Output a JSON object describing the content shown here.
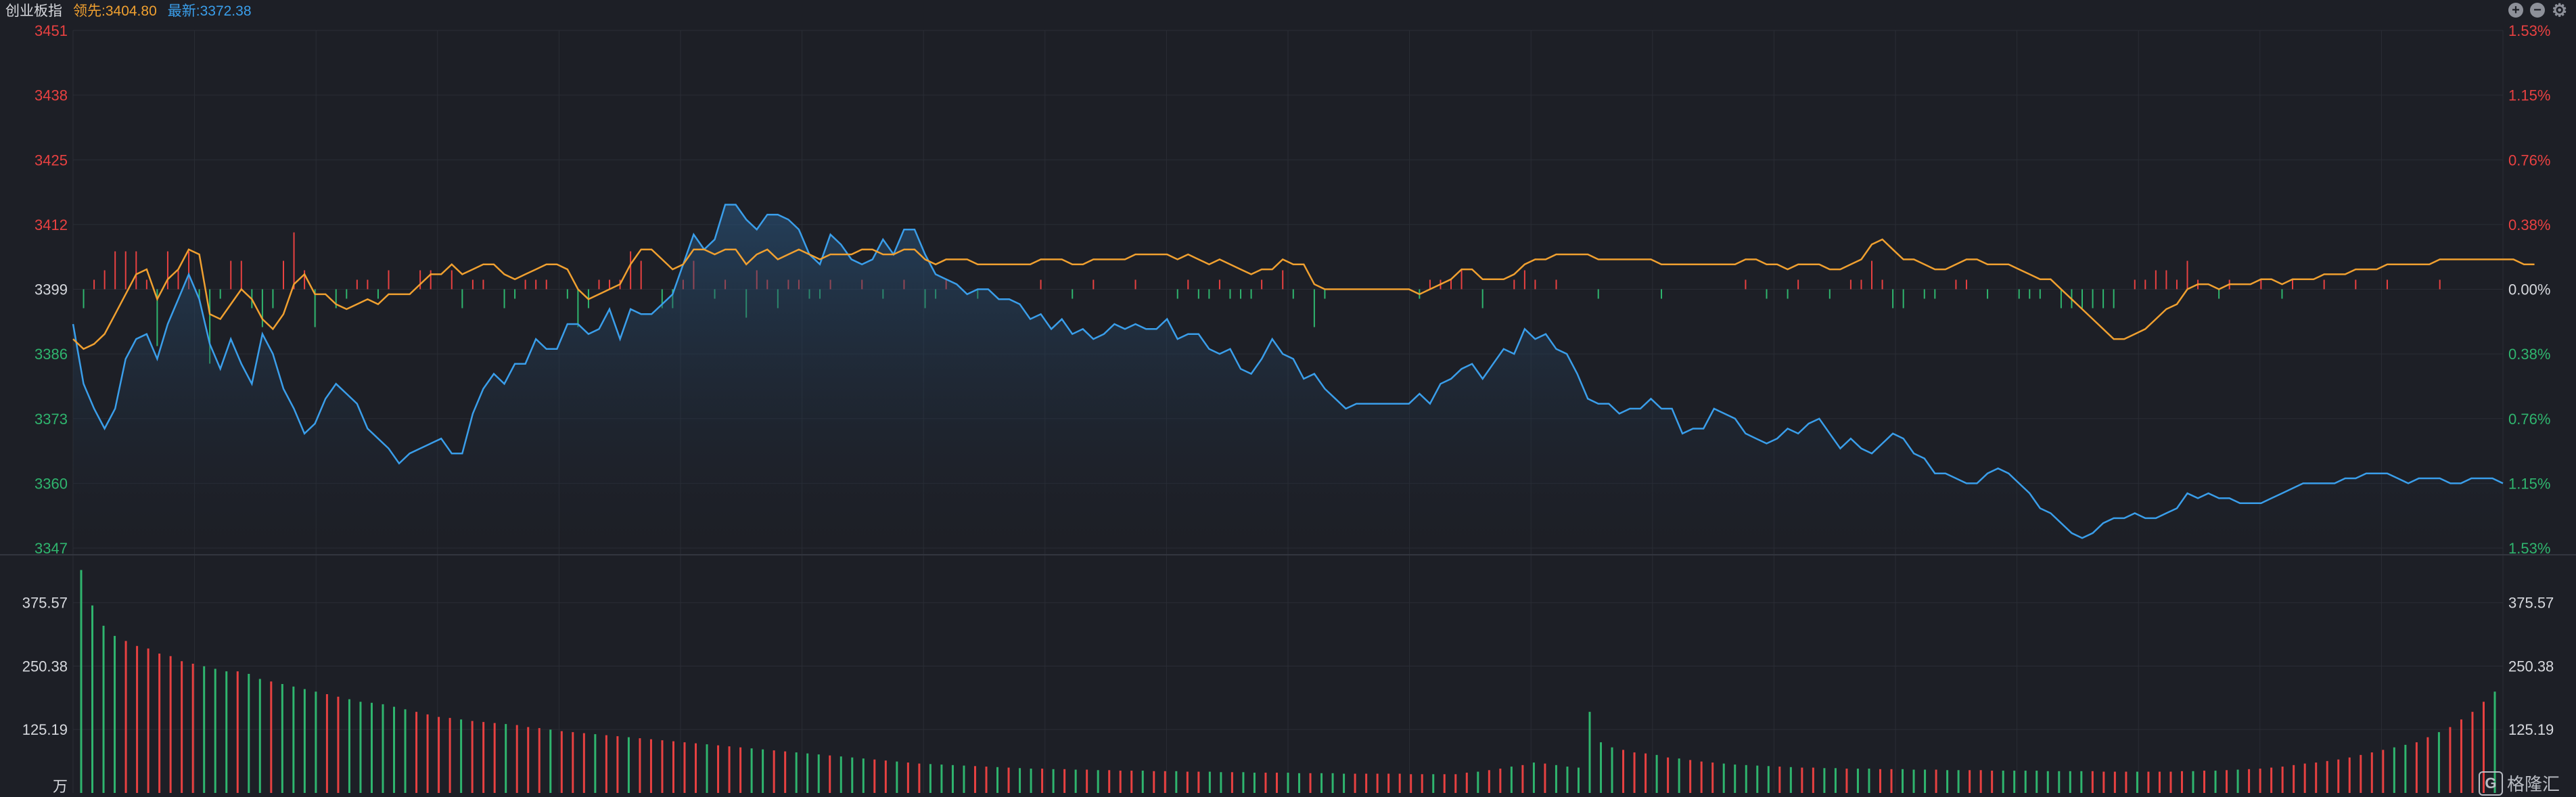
{
  "header": {
    "title": "创业板指",
    "lead_label": "领先:3404.80",
    "last_label": "最新:3372.38"
  },
  "controls": {
    "zoom_in": "+",
    "zoom_out": "−",
    "settings": "⚙"
  },
  "watermark": "格隆汇",
  "colors": {
    "background": "#1d1f26",
    "price_line": "#3a9eea",
    "lead_line": "#f0a030",
    "up": "#e84141",
    "down": "#2fb56e",
    "axis_text": "#d6d8dd",
    "grid": "#2a2d35"
  },
  "chart_data": [
    {
      "type": "line",
      "title": "创业板指",
      "y_left_ticks": [
        "3451",
        "3438",
        "3425",
        "3412",
        "3399",
        "3386",
        "3373",
        "3360",
        "3347"
      ],
      "y_right_ticks": [
        "1.53%",
        "1.15%",
        "0.76%",
        "0.38%",
        "0.00%",
        "0.38%",
        "0.76%",
        "1.15%",
        "1.53%"
      ],
      "ylim": [
        3347,
        3451
      ],
      "prev_close": 3399,
      "grid": true,
      "series": [
        {
          "name": "最新",
          "color": "#3a9eea",
          "values": [
            3392,
            3380,
            3375,
            3371,
            3375,
            3385,
            3389,
            3390,
            3385,
            3392,
            3397,
            3402,
            3397,
            3388,
            3383,
            3389,
            3384,
            3380,
            3390,
            3386,
            3379,
            3375,
            3370,
            3372,
            3377,
            3380,
            3378,
            3376,
            3371,
            3369,
            3367,
            3364,
            3366,
            3367,
            3368,
            3369,
            3366,
            3366,
            3374,
            3379,
            3382,
            3380,
            3384,
            3384,
            3389,
            3387,
            3387,
            3392,
            3392,
            3390,
            3391,
            3395,
            3389,
            3395,
            3394,
            3394,
            3396,
            3398,
            3404,
            3410,
            3407,
            3409,
            3416,
            3416,
            3413,
            3411,
            3414,
            3414,
            3413,
            3411,
            3406,
            3404,
            3410,
            3408,
            3405,
            3404,
            3405,
            3409,
            3406,
            3411,
            3411,
            3406,
            3402,
            3401,
            3400,
            3398,
            3399,
            3399,
            3397,
            3397,
            3396,
            3393,
            3394,
            3391,
            3393,
            3390,
            3391,
            3389,
            3390,
            3392,
            3391,
            3392,
            3391,
            3391,
            3393,
            3389,
            3390,
            3390,
            3387,
            3386,
            3387,
            3383,
            3382,
            3385,
            3389,
            3386,
            3385,
            3381,
            3382,
            3379,
            3377,
            3375,
            3376,
            3376,
            3376,
            3376,
            3376,
            3376,
            3378,
            3376,
            3380,
            3381,
            3383,
            3384,
            3381,
            3384,
            3387,
            3386,
            3391,
            3389,
            3390,
            3387,
            3386,
            3382,
            3377,
            3376,
            3376,
            3374,
            3375,
            3375,
            3377,
            3375,
            3375,
            3370,
            3371,
            3371,
            3375,
            3374,
            3373,
            3370,
            3369,
            3368,
            3369,
            3371,
            3370,
            3372,
            3373,
            3370,
            3367,
            3369,
            3367,
            3366,
            3368,
            3370,
            3369,
            3366,
            3365,
            3362,
            3362,
            3361,
            3360,
            3360,
            3362,
            3363,
            3362,
            3360,
            3358,
            3355,
            3354,
            3352,
            3350,
            3349,
            3350,
            3352,
            3353,
            3353,
            3354,
            3353,
            3353,
            3354,
            3355,
            3358,
            3357,
            3358,
            3357,
            3357,
            3356,
            3356,
            3356,
            3357,
            3358,
            3359,
            3360,
            3360,
            3360,
            3360,
            3361,
            3361,
            3362,
            3362,
            3362,
            3361,
            3360,
            3361,
            3361,
            3361,
            3360,
            3360,
            3361,
            3361,
            3361,
            3360
          ]
        },
        {
          "name": "领先",
          "color": "#f0a030",
          "values": [
            3389,
            3387,
            3388,
            3390,
            3394,
            3398,
            3402,
            3403,
            3397,
            3401,
            3403,
            3407,
            3406,
            3394,
            3393,
            3396,
            3399,
            3397,
            3393,
            3391,
            3394,
            3400,
            3402,
            3398,
            3398,
            3396,
            3395,
            3396,
            3397,
            3396,
            3398,
            3398,
            3398,
            3400,
            3402,
            3402,
            3404,
            3402,
            3403,
            3404,
            3404,
            3402,
            3401,
            3402,
            3403,
            3404,
            3404,
            3403,
            3399,
            3397,
            3398,
            3399,
            3400,
            3404,
            3407,
            3407,
            3405,
            3403,
            3404,
            3407,
            3407,
            3406,
            3407,
            3407,
            3404,
            3406,
            3407,
            3405,
            3406,
            3407,
            3406,
            3405,
            3406,
            3406,
            3406,
            3407,
            3407,
            3406,
            3406,
            3407,
            3407,
            3405,
            3404,
            3405,
            3405,
            3405,
            3404,
            3404,
            3404,
            3404,
            3404,
            3404,
            3405,
            3405,
            3405,
            3404,
            3404,
            3405,
            3405,
            3405,
            3405,
            3406,
            3406,
            3406,
            3406,
            3405,
            3406,
            3405,
            3404,
            3405,
            3404,
            3403,
            3402,
            3403,
            3403,
            3405,
            3404,
            3404,
            3400,
            3399,
            3399,
            3399,
            3399,
            3399,
            3399,
            3399,
            3399,
            3399,
            3398,
            3399,
            3400,
            3401,
            3403,
            3403,
            3401,
            3401,
            3401,
            3402,
            3404,
            3405,
            3405,
            3406,
            3406,
            3406,
            3406,
            3405,
            3405,
            3405,
            3405,
            3405,
            3405,
            3404,
            3404,
            3404,
            3404,
            3404,
            3404,
            3404,
            3404,
            3405,
            3405,
            3404,
            3404,
            3403,
            3404,
            3404,
            3404,
            3403,
            3403,
            3404,
            3405,
            3408,
            3409,
            3407,
            3405,
            3405,
            3404,
            3403,
            3403,
            3404,
            3405,
            3405,
            3404,
            3404,
            3404,
            3403,
            3402,
            3401,
            3401,
            3399,
            3397,
            3395,
            3393,
            3391,
            3389,
            3389,
            3390,
            3391,
            3393,
            3395,
            3396,
            3399,
            3400,
            3400,
            3399,
            3400,
            3400,
            3400,
            3401,
            3401,
            3400,
            3401,
            3401,
            3401,
            3402,
            3402,
            3402,
            3403,
            3403,
            3403,
            3404,
            3404,
            3404,
            3404,
            3404,
            3405,
            3405,
            3405,
            3405,
            3405,
            3405,
            3405,
            3405,
            3404,
            3404
          ]
        }
      ]
    },
    {
      "type": "bar",
      "title": "",
      "y_ticks": [
        "375.57",
        "250.38",
        "125.19"
      ],
      "unit_label": "万",
      "ylim": [
        0,
        470
      ],
      "values": [
        440,
        370,
        330,
        310,
        300,
        290,
        285,
        275,
        270,
        260,
        255,
        250,
        245,
        240,
        240,
        235,
        225,
        220,
        215,
        210,
        205,
        200,
        195,
        190,
        185,
        180,
        178,
        175,
        170,
        165,
        160,
        155,
        150,
        148,
        145,
        142,
        140,
        138,
        136,
        134,
        130,
        128,
        125,
        122,
        120,
        118,
        116,
        114,
        112,
        110,
        108,
        106,
        104,
        102,
        100,
        98,
        96,
        94,
        92,
        90,
        88,
        86,
        84,
        82,
        80,
        78,
        76,
        74,
        72,
        70,
        68,
        66,
        64,
        62,
        60,
        58,
        57,
        56,
        55,
        54,
        53,
        52,
        51,
        50,
        49,
        48,
        48,
        47,
        47,
        46,
        46,
        45,
        45,
        44,
        44,
        44,
        43,
        43,
        43,
        42,
        42,
        42,
        41,
        41,
        41,
        40,
        40,
        40,
        40,
        39,
        39,
        39,
        39,
        38,
        38,
        38,
        38,
        38,
        38,
        37,
        37,
        37,
        37,
        37,
        40,
        42,
        45,
        48,
        52,
        55,
        60,
        58,
        55,
        52,
        50,
        160,
        100,
        90,
        85,
        80,
        78,
        75,
        70,
        68,
        65,
        62,
        60,
        58,
        56,
        55,
        54,
        53,
        52,
        51,
        50,
        50,
        49,
        49,
        48,
        48,
        48,
        47,
        47,
        47,
        46,
        46,
        46,
        45,
        45,
        45,
        45,
        44,
        44,
        44,
        44,
        44,
        43,
        43,
        43,
        43,
        43,
        42,
        42,
        42,
        42,
        42,
        42,
        42,
        43,
        43,
        44,
        44,
        45,
        46,
        47,
        48,
        50,
        52,
        55,
        58,
        60,
        63,
        66,
        70,
        75,
        80,
        85,
        90,
        95,
        100,
        110,
        120,
        130,
        145,
        160,
        180,
        200
      ]
    }
  ]
}
